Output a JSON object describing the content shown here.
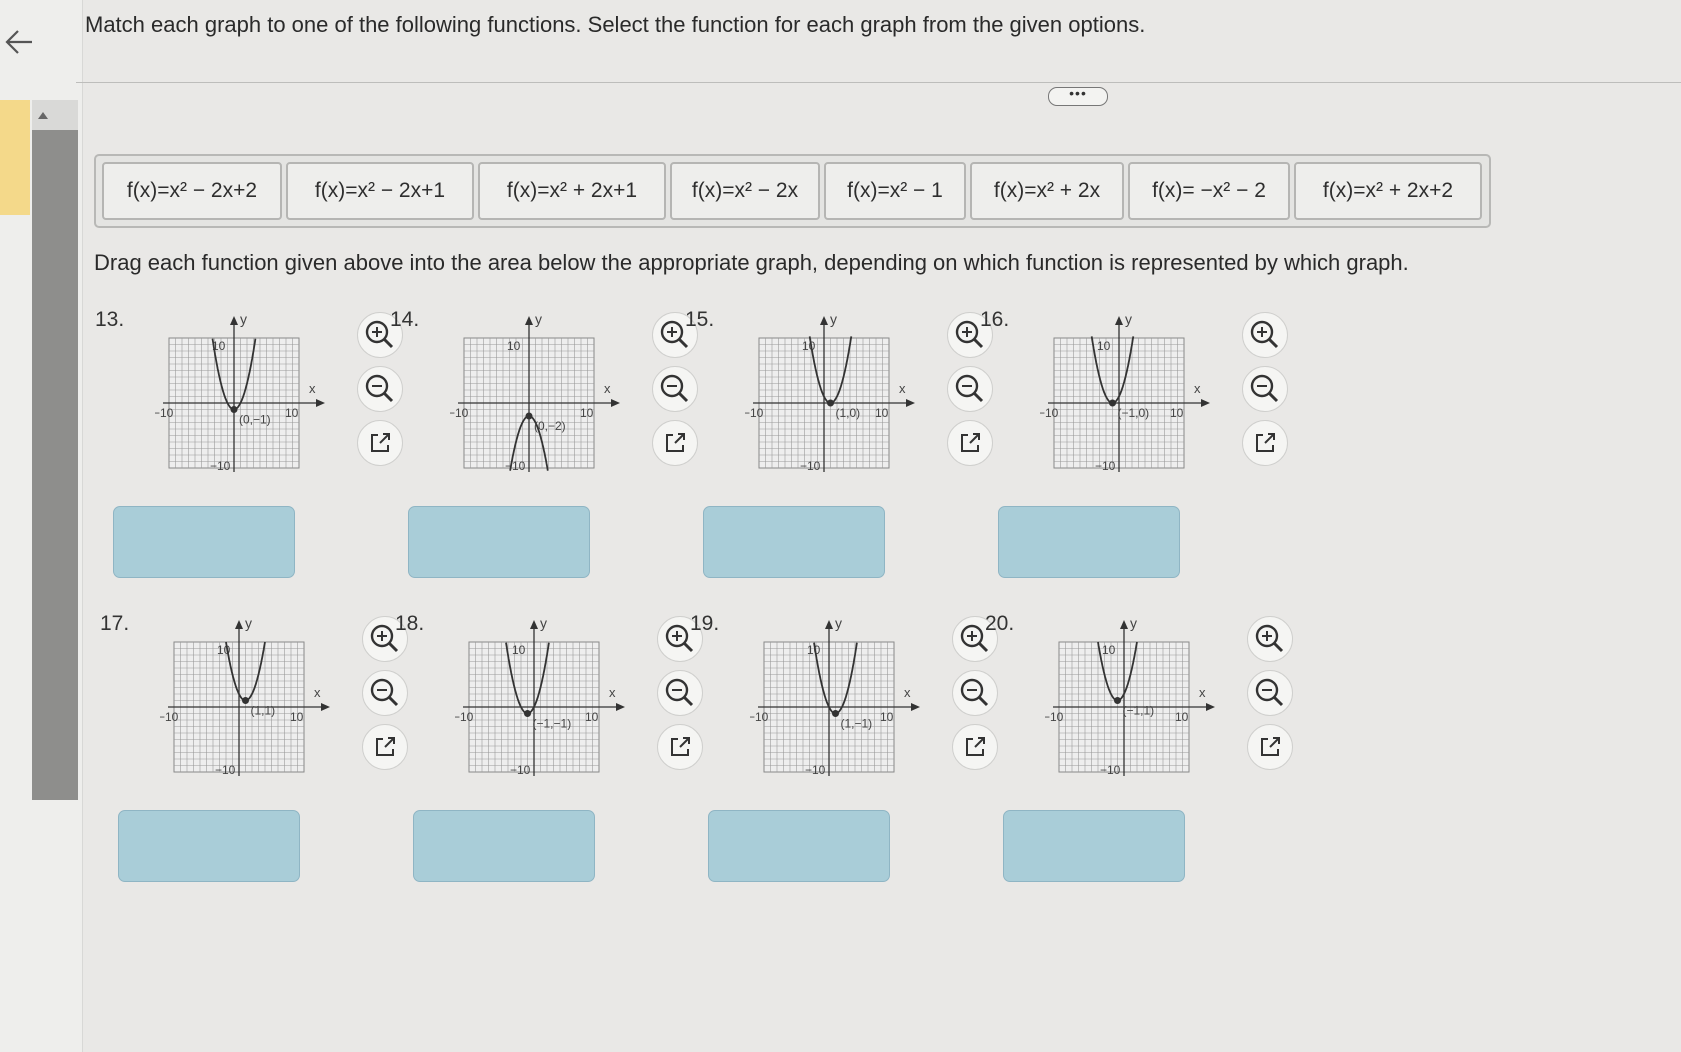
{
  "instruction": "Match each graph to one of the following functions. Select the function for each graph from the given options.",
  "more_button": "•••",
  "functions": [
    "f(x)=x² − 2x+2",
    "f(x)=x² − 2x+1",
    "f(x)=x² + 2x+1",
    "f(x)=x² − 2x",
    "f(x)=x² − 1",
    "f(x)=x² + 2x",
    "f(x)= −x² − 2",
    "f(x)=x² + 2x+2"
  ],
  "drag_instruction": "Drag each function given above into the area below the appropriate graph, depending on which function is represented by which graph.",
  "graphs": [
    {
      "number": "13.",
      "vertex_label": "(0,−1)",
      "vertex": [
        0,
        -1
      ],
      "opens": "up",
      "answer": ""
    },
    {
      "number": "14.",
      "vertex_label": "(0,−2)",
      "vertex": [
        0,
        -2
      ],
      "opens": "down",
      "answer": ""
    },
    {
      "number": "15.",
      "vertex_label": "(1,0)",
      "vertex": [
        1,
        0
      ],
      "opens": "up",
      "answer": ""
    },
    {
      "number": "16.",
      "vertex_label": "(−1,0)",
      "vertex": [
        -1,
        0
      ],
      "opens": "up",
      "answer": ""
    },
    {
      "number": "17.",
      "vertex_label": "(1,1)",
      "vertex": [
        1,
        1
      ],
      "opens": "up",
      "answer": ""
    },
    {
      "number": "18.",
      "vertex_label": "(−1,−1)",
      "vertex": [
        -1,
        -1
      ],
      "opens": "up",
      "answer": ""
    },
    {
      "number": "19.",
      "vertex_label": "(1,−1)",
      "vertex": [
        1,
        -1
      ],
      "opens": "up",
      "answer": ""
    },
    {
      "number": "20.",
      "vertex_label": "(−1,1)",
      "vertex": [
        -1,
        1
      ],
      "opens": "up",
      "answer": ""
    }
  ],
  "axis": {
    "x_label": "x",
    "y_label": "y",
    "max": "10",
    "min": "−10"
  }
}
